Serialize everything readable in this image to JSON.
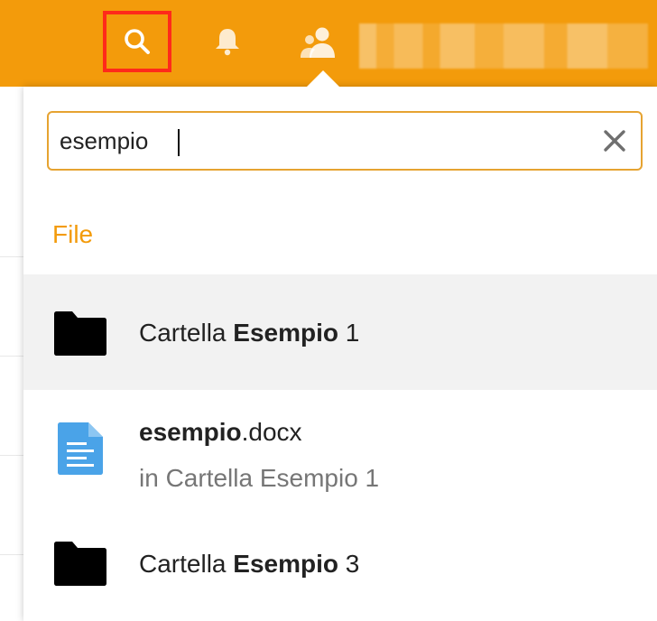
{
  "header": {
    "search_icon": "search-icon",
    "notifications_icon": "bell-icon",
    "contacts_icon": "contacts-icon",
    "username": ""
  },
  "search": {
    "value": "esempio",
    "clear_icon": "close-icon"
  },
  "results": {
    "section_title": "File",
    "items": [
      {
        "type": "folder",
        "icon": "folder-icon",
        "prefix": "Cartella ",
        "match": "Esempio",
        "suffix": " 1",
        "location": ""
      },
      {
        "type": "file",
        "icon": "document-icon",
        "prefix": "",
        "match": "esempio",
        "suffix": ".docx",
        "location": "in Cartella Esempio 1"
      },
      {
        "type": "folder",
        "icon": "folder-icon",
        "prefix": "Cartella ",
        "match": "Esempio",
        "suffix": " 3",
        "location": ""
      }
    ]
  },
  "colors": {
    "header_bg": "#f39b0b",
    "accent": "#f39b0b",
    "highlight_box": "#ff2a1a",
    "search_border": "#e6a331",
    "doc_icon": "#4aa3e8",
    "hover_row": "#f2f2f2"
  }
}
